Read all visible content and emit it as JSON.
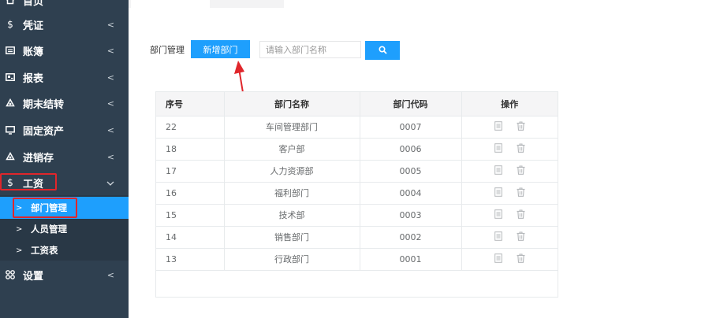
{
  "sidebar": {
    "items": [
      {
        "label": "首页",
        "icon": "home-icon"
      },
      {
        "label": "凭证",
        "icon": "dollar-icon"
      },
      {
        "label": "账簿",
        "icon": "ledger-icon"
      },
      {
        "label": "报表",
        "icon": "report-icon"
      },
      {
        "label": "期末结转",
        "icon": "transfer-icon"
      },
      {
        "label": "固定资产",
        "icon": "monitor-icon"
      },
      {
        "label": "进销存",
        "icon": "inventory-icon"
      },
      {
        "label": "工资",
        "icon": "dollar-icon"
      },
      {
        "label": "设置",
        "icon": "grid-icon"
      }
    ],
    "sub_items": [
      {
        "label": "部门管理",
        "active": true
      },
      {
        "label": "人员管理",
        "active": false
      },
      {
        "label": "工资表",
        "active": false
      }
    ]
  },
  "toolbar": {
    "label": "部门管理",
    "add_button": "新增部门",
    "search_placeholder": "请输入部门名称"
  },
  "table": {
    "headers": [
      "序号",
      "部门名称",
      "部门代码",
      "操作"
    ],
    "rows": [
      {
        "no": "22",
        "name": "车间管理部门",
        "code": "0007"
      },
      {
        "no": "18",
        "name": "客户部",
        "code": "0006"
      },
      {
        "no": "17",
        "name": "人力资源部",
        "code": "0005"
      },
      {
        "no": "16",
        "name": "福利部门",
        "code": "0004"
      },
      {
        "no": "15",
        "name": "技术部",
        "code": "0003"
      },
      {
        "no": "14",
        "name": "销售部门",
        "code": "0002"
      },
      {
        "no": "13",
        "name": "行政部门",
        "code": "0001"
      }
    ]
  },
  "colors": {
    "sidebar_bg": "#2f4050",
    "accent": "#1e9ffd",
    "highlight": "#e0262b"
  }
}
